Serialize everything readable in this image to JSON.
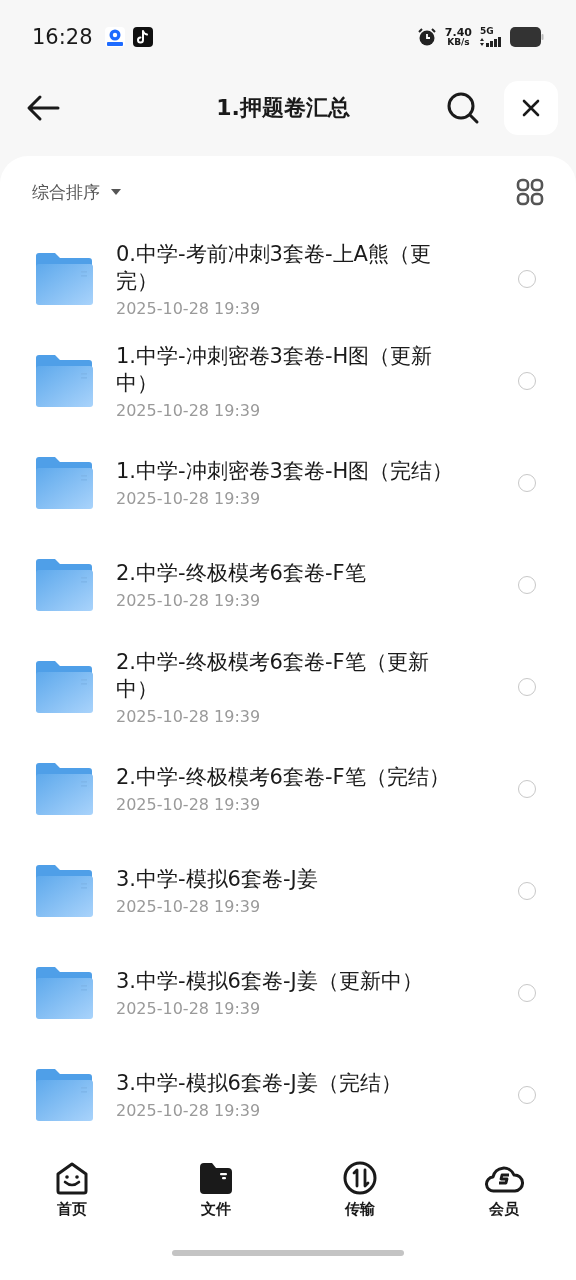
{
  "status_bar": {
    "time": "16:28",
    "speed_value": "7.40",
    "speed_unit": "KB/s",
    "network": "5G"
  },
  "header": {
    "title": "1.押题卷汇总"
  },
  "sort": {
    "label": "综合排序"
  },
  "files": [
    {
      "name": "0.中学-考前冲刺3套卷-上A熊（更完）",
      "date": "2025-10-28 19:39",
      "selected": false
    },
    {
      "name": "1.中学-冲刺密卷3套卷-H图（更新中）",
      "date": "2025-10-28 19:39",
      "selected": false
    },
    {
      "name": "1.中学-冲刺密卷3套卷-H图（完结）",
      "date": "2025-10-28 19:39",
      "selected": false
    },
    {
      "name": "2.中学-终极模考6套卷-F笔",
      "date": "2025-10-28 19:39",
      "selected": false
    },
    {
      "name": "2.中学-终极模考6套卷-F笔（更新中）",
      "date": "2025-10-28 19:39",
      "selected": false
    },
    {
      "name": "2.中学-终极模考6套卷-F笔（完结）",
      "date": "2025-10-28 19:39",
      "selected": false
    },
    {
      "name": "3.中学-模拟6套卷-J姜",
      "date": "2025-10-28 19:39",
      "selected": false
    },
    {
      "name": "3.中学-模拟6套卷-J姜（更新中）",
      "date": "2025-10-28 19:39",
      "selected": false
    },
    {
      "name": "3.中学-模拟6套卷-J姜（完结）",
      "date": "2025-10-28 19:39",
      "selected": false
    }
  ],
  "nav": [
    {
      "label": "首页",
      "kind": "home",
      "selected": false
    },
    {
      "label": "文件",
      "kind": "files",
      "selected": true
    },
    {
      "label": "传输",
      "kind": "transfer",
      "selected": false
    },
    {
      "label": "会员",
      "kind": "member",
      "selected": false
    }
  ]
}
